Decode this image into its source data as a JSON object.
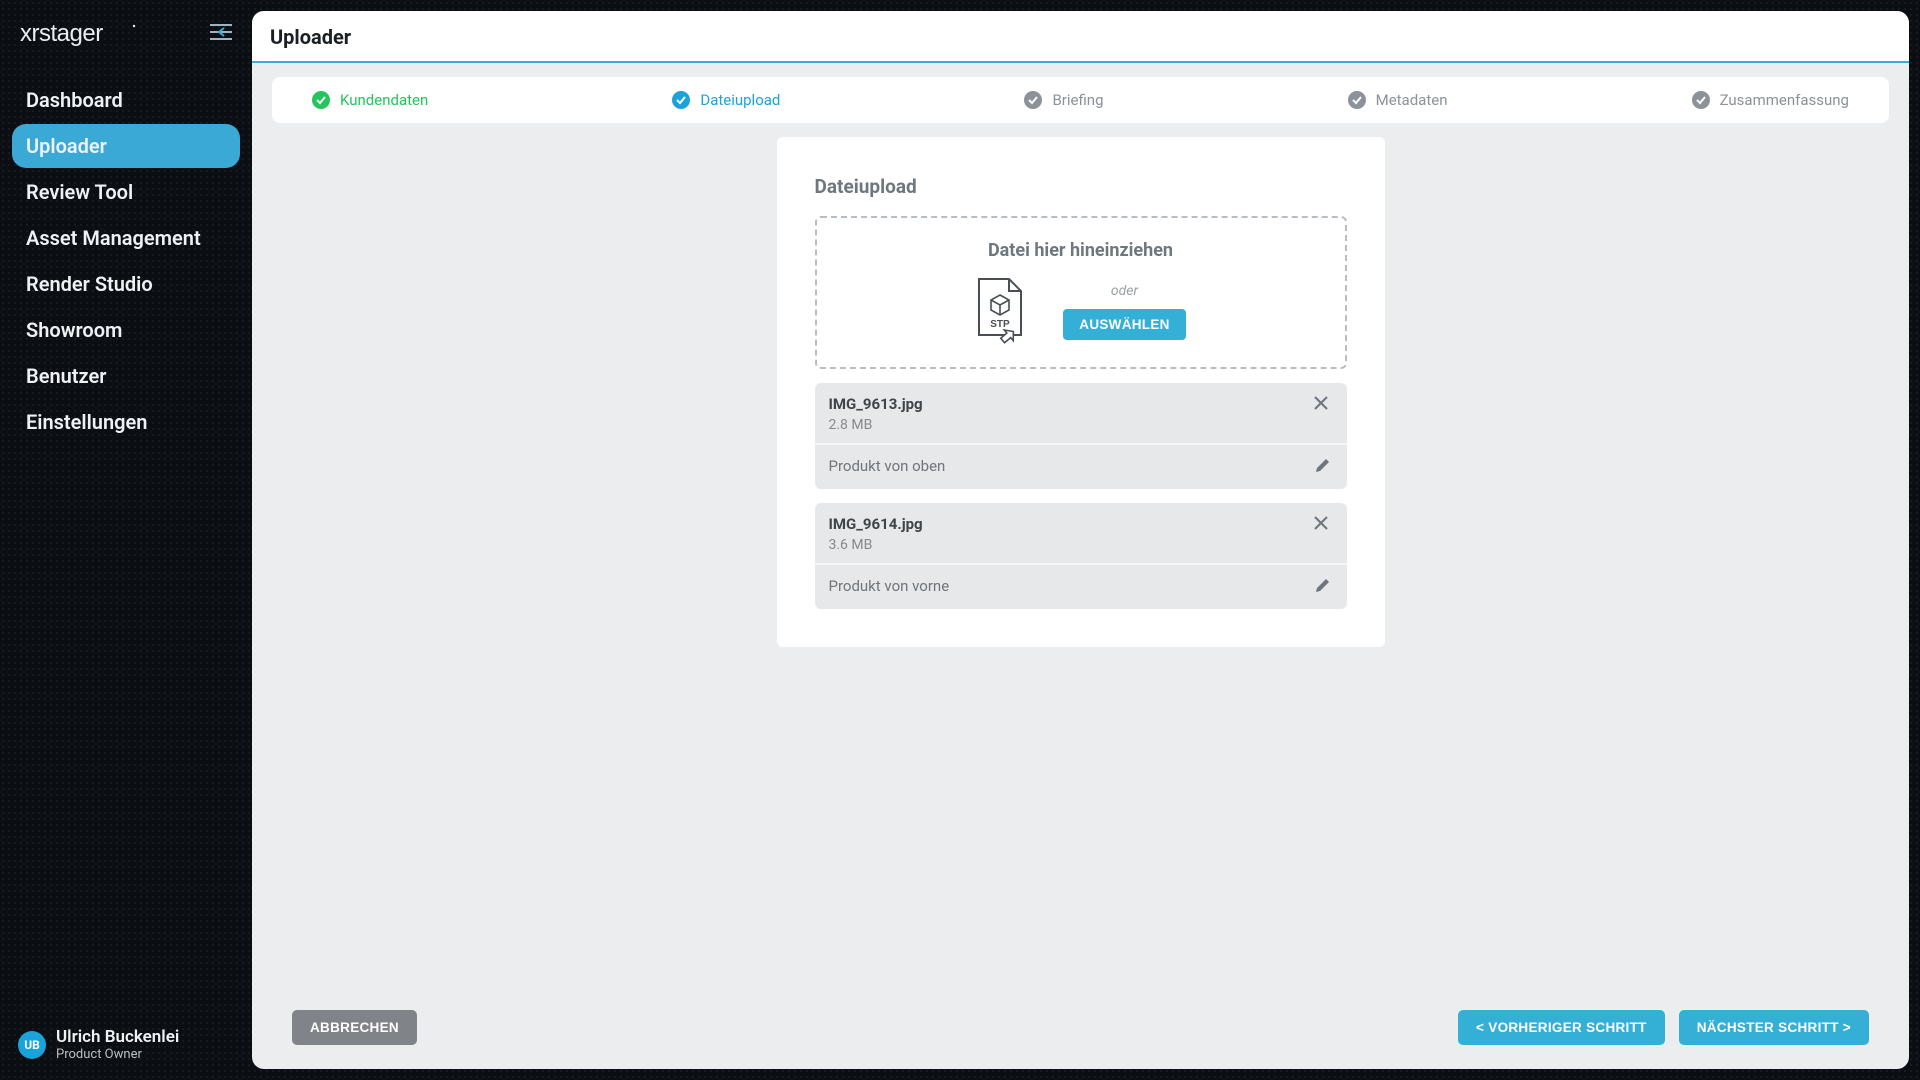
{
  "brand": {
    "name": "xrstager"
  },
  "sidebar": {
    "items": [
      {
        "label": "Dashboard"
      },
      {
        "label": "Uploader"
      },
      {
        "label": "Review Tool"
      },
      {
        "label": "Asset Management"
      },
      {
        "label": "Render Studio"
      },
      {
        "label": "Showroom"
      },
      {
        "label": "Benutzer"
      },
      {
        "label": "Einstellungen"
      }
    ],
    "active_index": 1
  },
  "user": {
    "initials": "UB",
    "name": "Ulrich Buckenlei",
    "role": "Product Owner"
  },
  "header": {
    "title": "Uploader"
  },
  "stepper": {
    "steps": [
      {
        "label": "Kundendaten",
        "state": "done"
      },
      {
        "label": "Dateiupload",
        "state": "active"
      },
      {
        "label": "Briefing",
        "state": "pending"
      },
      {
        "label": "Metadaten",
        "state": "pending"
      },
      {
        "label": "Zusammenfassung",
        "state": "pending"
      }
    ]
  },
  "upload": {
    "section_title": "Dateiupload",
    "dropzone": {
      "heading": "Datei hier hineinziehen",
      "or": "oder",
      "select_label": "AUSWÄHLEN",
      "icon_ext": "STP"
    },
    "files": [
      {
        "name": "IMG_9613.jpg",
        "size": "2.8 MB",
        "description": "Produkt von oben"
      },
      {
        "name": "IMG_9614.jpg",
        "size": "3.6 MB",
        "description": "Produkt von vorne"
      }
    ]
  },
  "footer": {
    "cancel": "ABBRECHEN",
    "prev": "< VORHERIGER SCHRITT",
    "next": "NÄCHSTER SCHRITT >"
  },
  "colors": {
    "accent": "#34b0d6",
    "success": "#22c55e",
    "muted": "#8b9299"
  }
}
